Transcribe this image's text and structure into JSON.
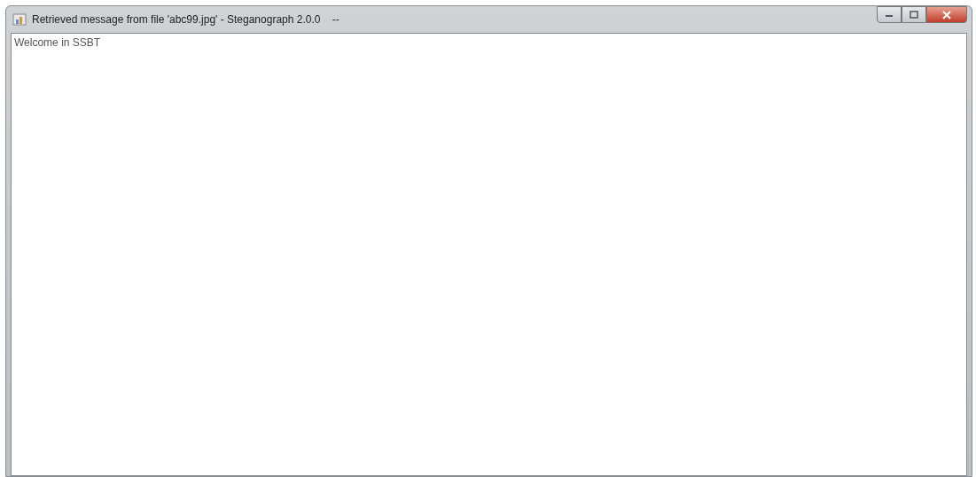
{
  "window": {
    "title": "Retrieved message from file 'abc99.jpg' - Steganograph 2.0.0    --"
  },
  "message": {
    "value": "Welcome in SSBT"
  }
}
